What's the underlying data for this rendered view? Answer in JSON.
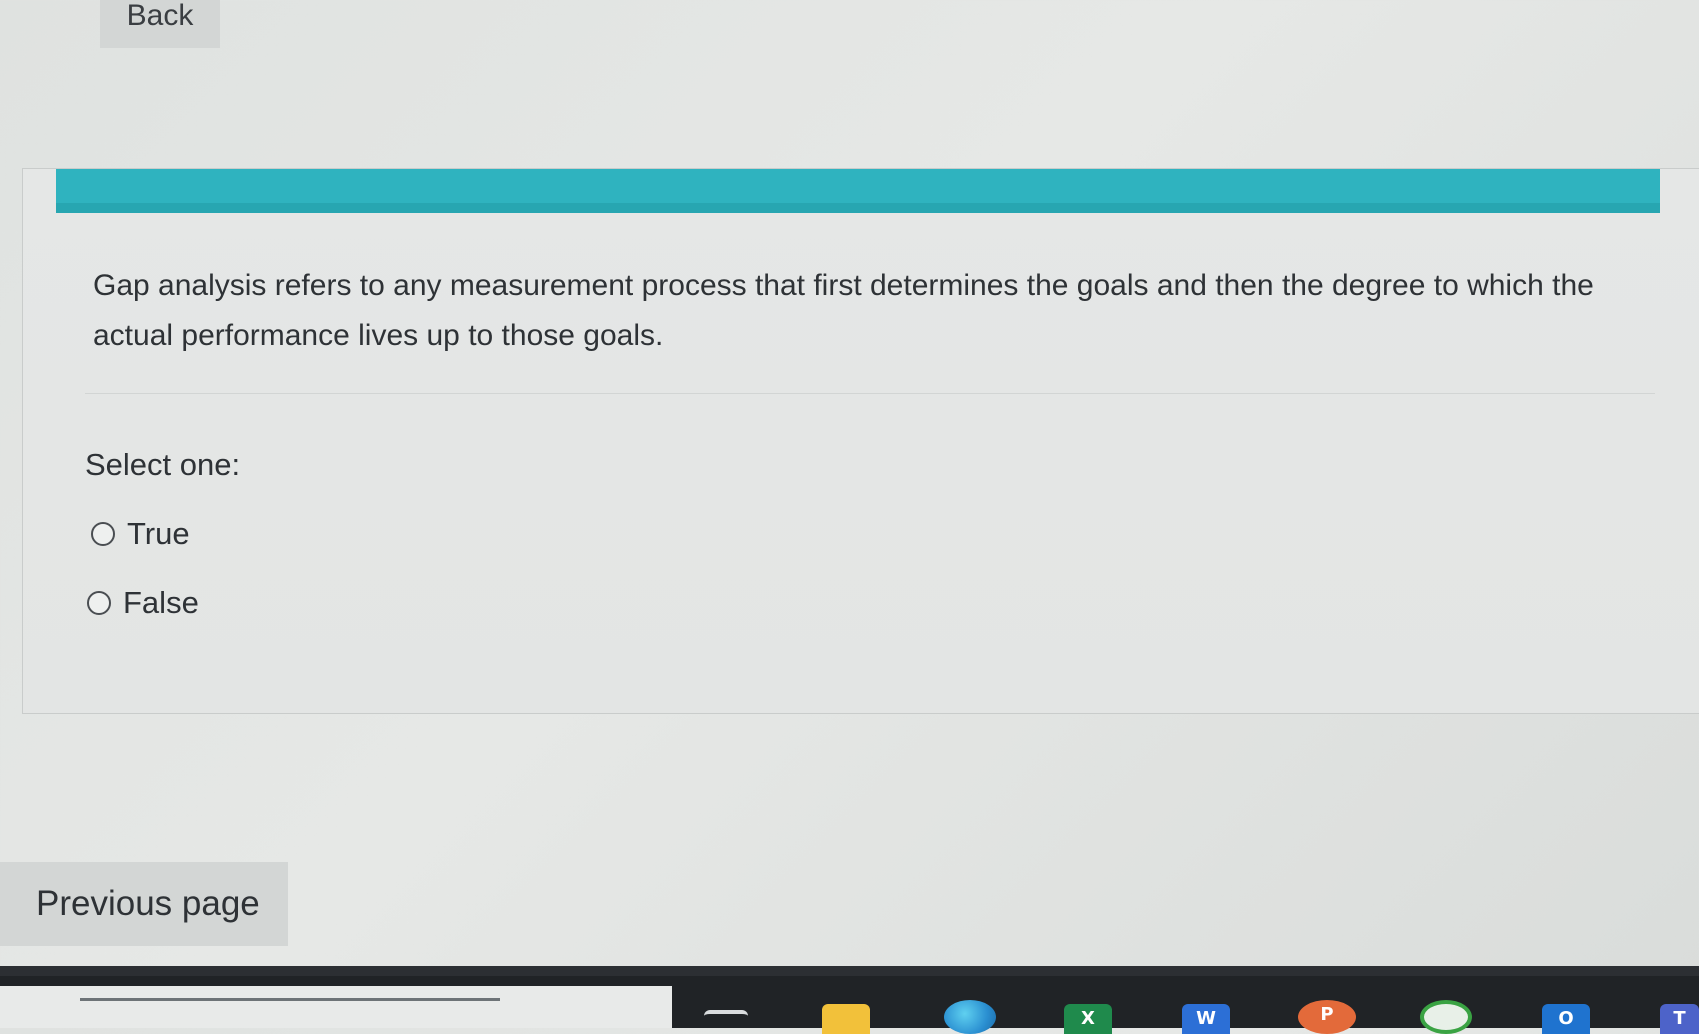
{
  "nav": {
    "back_label": "Back"
  },
  "question": {
    "text": "Gap analysis refers to any measurement process that first determines the goals and then the degree to which the actual performance lives up to those goals.",
    "prompt": "Select one:",
    "options": [
      {
        "label": "True",
        "selected": false
      },
      {
        "label": "False",
        "selected": false
      }
    ]
  },
  "footer": {
    "previous_label": "Previous page"
  },
  "taskbar": {
    "icons": [
      "task-view-icon",
      "file-explorer-icon",
      "edge-icon",
      "excel-icon",
      "word-icon",
      "powerpoint-icon",
      "xbox-icon",
      "outlook-icon",
      "teams-icon"
    ],
    "letters": {
      "excel": "X",
      "word": "W",
      "powerpoint": "P",
      "outlook": "O",
      "teams": "T"
    }
  },
  "colors": {
    "accent_bar": "#2fb3bf",
    "page_bg": "#e2e4e3",
    "taskbar_bg": "#202326"
  }
}
